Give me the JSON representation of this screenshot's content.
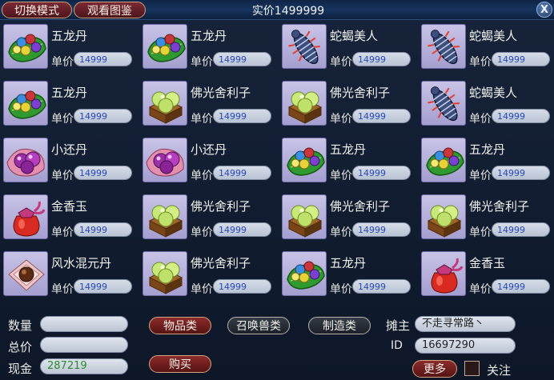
{
  "titlebar": {
    "mode_label": "切换模式",
    "atlas_label": "观看图鉴",
    "title": "实价1499999",
    "close_label": "X"
  },
  "price_label": "单价",
  "items": [
    {
      "name": "五龙丹",
      "price": "14999",
      "icon": "wulong"
    },
    {
      "name": "五龙丹",
      "price": "14999",
      "icon": "wulong"
    },
    {
      "name": "蛇蝎美人",
      "price": "14999",
      "icon": "shexie"
    },
    {
      "name": "蛇蝎美人",
      "price": "14999",
      "icon": "shexie"
    },
    {
      "name": "五龙丹",
      "price": "14999",
      "icon": "wulong"
    },
    {
      "name": "佛光舍利子",
      "price": "14999",
      "icon": "foguang"
    },
    {
      "name": "佛光舍利子",
      "price": "14999",
      "icon": "foguang"
    },
    {
      "name": "蛇蝎美人",
      "price": "14999",
      "icon": "shexie"
    },
    {
      "name": "小还丹",
      "price": "14999",
      "icon": "xiaohuan"
    },
    {
      "name": "小还丹",
      "price": "14999",
      "icon": "xiaohuan"
    },
    {
      "name": "五龙丹",
      "price": "14999",
      "icon": "wulong"
    },
    {
      "name": "五龙丹",
      "price": "14999",
      "icon": "wulong"
    },
    {
      "name": "金香玉",
      "price": "14999",
      "icon": "jinxiang"
    },
    {
      "name": "佛光舍利子",
      "price": "14999",
      "icon": "foguang"
    },
    {
      "name": "佛光舍利子",
      "price": "14999",
      "icon": "foguang"
    },
    {
      "name": "佛光舍利子",
      "price": "14999",
      "icon": "foguang"
    },
    {
      "name": "风水混元丹",
      "price": "14999",
      "icon": "fengshui"
    },
    {
      "name": "佛光舍利子",
      "price": "14999",
      "icon": "foguang"
    },
    {
      "name": "五龙丹",
      "price": "14999",
      "icon": "wulong"
    },
    {
      "name": "金香玉",
      "price": "14999",
      "icon": "jinxiang"
    }
  ],
  "bottom": {
    "qty_label": "数量",
    "qty_value": "",
    "total_label": "总价",
    "total_value": "",
    "cash_label": "现金",
    "cash_value": "287219",
    "cat_items": "物品类",
    "cat_summon": "召唤兽类",
    "cat_craft": "制造类",
    "buy_label": "购买",
    "owner_label": "摊主",
    "owner_value": "不走寻常路丶",
    "id_label": "ID",
    "id_value": "16697290",
    "more_label": "更多",
    "follow_label": "关注"
  }
}
